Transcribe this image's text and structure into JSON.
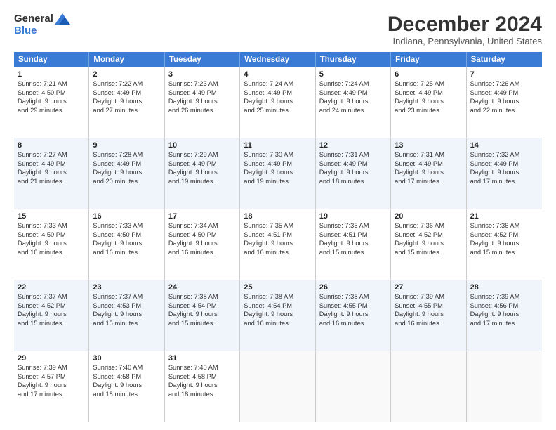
{
  "header": {
    "logo_general": "General",
    "logo_blue": "Blue",
    "main_title": "December 2024",
    "subtitle": "Indiana, Pennsylvania, United States"
  },
  "calendar": {
    "days_of_week": [
      "Sunday",
      "Monday",
      "Tuesday",
      "Wednesday",
      "Thursday",
      "Friday",
      "Saturday"
    ],
    "rows": [
      [
        {
          "day": "1",
          "lines": [
            "Sunrise: 7:21 AM",
            "Sunset: 4:50 PM",
            "Daylight: 9 hours",
            "and 29 minutes."
          ]
        },
        {
          "day": "2",
          "lines": [
            "Sunrise: 7:22 AM",
            "Sunset: 4:49 PM",
            "Daylight: 9 hours",
            "and 27 minutes."
          ]
        },
        {
          "day": "3",
          "lines": [
            "Sunrise: 7:23 AM",
            "Sunset: 4:49 PM",
            "Daylight: 9 hours",
            "and 26 minutes."
          ]
        },
        {
          "day": "4",
          "lines": [
            "Sunrise: 7:24 AM",
            "Sunset: 4:49 PM",
            "Daylight: 9 hours",
            "and 25 minutes."
          ]
        },
        {
          "day": "5",
          "lines": [
            "Sunrise: 7:24 AM",
            "Sunset: 4:49 PM",
            "Daylight: 9 hours",
            "and 24 minutes."
          ]
        },
        {
          "day": "6",
          "lines": [
            "Sunrise: 7:25 AM",
            "Sunset: 4:49 PM",
            "Daylight: 9 hours",
            "and 23 minutes."
          ]
        },
        {
          "day": "7",
          "lines": [
            "Sunrise: 7:26 AM",
            "Sunset: 4:49 PM",
            "Daylight: 9 hours",
            "and 22 minutes."
          ]
        }
      ],
      [
        {
          "day": "8",
          "lines": [
            "Sunrise: 7:27 AM",
            "Sunset: 4:49 PM",
            "Daylight: 9 hours",
            "and 21 minutes."
          ]
        },
        {
          "day": "9",
          "lines": [
            "Sunrise: 7:28 AM",
            "Sunset: 4:49 PM",
            "Daylight: 9 hours",
            "and 20 minutes."
          ]
        },
        {
          "day": "10",
          "lines": [
            "Sunrise: 7:29 AM",
            "Sunset: 4:49 PM",
            "Daylight: 9 hours",
            "and 19 minutes."
          ]
        },
        {
          "day": "11",
          "lines": [
            "Sunrise: 7:30 AM",
            "Sunset: 4:49 PM",
            "Daylight: 9 hours",
            "and 19 minutes."
          ]
        },
        {
          "day": "12",
          "lines": [
            "Sunrise: 7:31 AM",
            "Sunset: 4:49 PM",
            "Daylight: 9 hours",
            "and 18 minutes."
          ]
        },
        {
          "day": "13",
          "lines": [
            "Sunrise: 7:31 AM",
            "Sunset: 4:49 PM",
            "Daylight: 9 hours",
            "and 17 minutes."
          ]
        },
        {
          "day": "14",
          "lines": [
            "Sunrise: 7:32 AM",
            "Sunset: 4:49 PM",
            "Daylight: 9 hours",
            "and 17 minutes."
          ]
        }
      ],
      [
        {
          "day": "15",
          "lines": [
            "Sunrise: 7:33 AM",
            "Sunset: 4:50 PM",
            "Daylight: 9 hours",
            "and 16 minutes."
          ]
        },
        {
          "day": "16",
          "lines": [
            "Sunrise: 7:33 AM",
            "Sunset: 4:50 PM",
            "Daylight: 9 hours",
            "and 16 minutes."
          ]
        },
        {
          "day": "17",
          "lines": [
            "Sunrise: 7:34 AM",
            "Sunset: 4:50 PM",
            "Daylight: 9 hours",
            "and 16 minutes."
          ]
        },
        {
          "day": "18",
          "lines": [
            "Sunrise: 7:35 AM",
            "Sunset: 4:51 PM",
            "Daylight: 9 hours",
            "and 16 minutes."
          ]
        },
        {
          "day": "19",
          "lines": [
            "Sunrise: 7:35 AM",
            "Sunset: 4:51 PM",
            "Daylight: 9 hours",
            "and 15 minutes."
          ]
        },
        {
          "day": "20",
          "lines": [
            "Sunrise: 7:36 AM",
            "Sunset: 4:52 PM",
            "Daylight: 9 hours",
            "and 15 minutes."
          ]
        },
        {
          "day": "21",
          "lines": [
            "Sunrise: 7:36 AM",
            "Sunset: 4:52 PM",
            "Daylight: 9 hours",
            "and 15 minutes."
          ]
        }
      ],
      [
        {
          "day": "22",
          "lines": [
            "Sunrise: 7:37 AM",
            "Sunset: 4:52 PM",
            "Daylight: 9 hours",
            "and 15 minutes."
          ]
        },
        {
          "day": "23",
          "lines": [
            "Sunrise: 7:37 AM",
            "Sunset: 4:53 PM",
            "Daylight: 9 hours",
            "and 15 minutes."
          ]
        },
        {
          "day": "24",
          "lines": [
            "Sunrise: 7:38 AM",
            "Sunset: 4:54 PM",
            "Daylight: 9 hours",
            "and 15 minutes."
          ]
        },
        {
          "day": "25",
          "lines": [
            "Sunrise: 7:38 AM",
            "Sunset: 4:54 PM",
            "Daylight: 9 hours",
            "and 16 minutes."
          ]
        },
        {
          "day": "26",
          "lines": [
            "Sunrise: 7:38 AM",
            "Sunset: 4:55 PM",
            "Daylight: 9 hours",
            "and 16 minutes."
          ]
        },
        {
          "day": "27",
          "lines": [
            "Sunrise: 7:39 AM",
            "Sunset: 4:55 PM",
            "Daylight: 9 hours",
            "and 16 minutes."
          ]
        },
        {
          "day": "28",
          "lines": [
            "Sunrise: 7:39 AM",
            "Sunset: 4:56 PM",
            "Daylight: 9 hours",
            "and 17 minutes."
          ]
        }
      ],
      [
        {
          "day": "29",
          "lines": [
            "Sunrise: 7:39 AM",
            "Sunset: 4:57 PM",
            "Daylight: 9 hours",
            "and 17 minutes."
          ]
        },
        {
          "day": "30",
          "lines": [
            "Sunrise: 7:40 AM",
            "Sunset: 4:58 PM",
            "Daylight: 9 hours",
            "and 18 minutes."
          ]
        },
        {
          "day": "31",
          "lines": [
            "Sunrise: 7:40 AM",
            "Sunset: 4:58 PM",
            "Daylight: 9 hours",
            "and 18 minutes."
          ]
        },
        {
          "day": "",
          "lines": []
        },
        {
          "day": "",
          "lines": []
        },
        {
          "day": "",
          "lines": []
        },
        {
          "day": "",
          "lines": []
        }
      ]
    ]
  }
}
